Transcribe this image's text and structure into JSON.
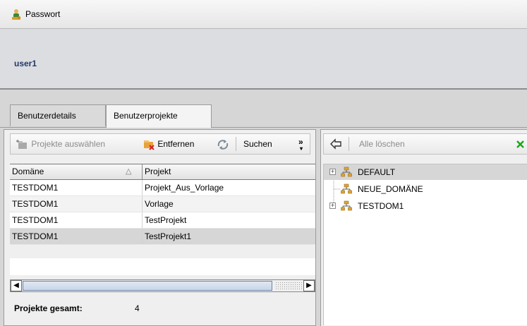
{
  "header": {
    "password_label": "Passwort",
    "user_name": "user1"
  },
  "tabs": [
    {
      "label": "Benutzerdetails",
      "active": false
    },
    {
      "label": "Benutzerprojekte",
      "active": true
    }
  ],
  "left_toolbar": {
    "select_projects": "Projekte auswählen",
    "remove": "Entfernen",
    "search": "Suchen",
    "overflow": "»"
  },
  "grid": {
    "columns": [
      "Domäne",
      "Projekt"
    ],
    "sort_indicator": "△",
    "rows": [
      {
        "domain": "TESTDOM1",
        "project": "Projekt_Aus_Vorlage"
      },
      {
        "domain": "TESTDOM1",
        "project": "Vorlage"
      },
      {
        "domain": "TESTDOM1",
        "project": "TestProjekt"
      },
      {
        "domain": "TESTDOM1",
        "project": "TestProjekt1"
      }
    ],
    "selected_row": 3
  },
  "totals": {
    "label": "Projekte gesamt:",
    "value": "4"
  },
  "right_toolbar": {
    "clear_all": "Alle löschen"
  },
  "tree": {
    "nodes": [
      {
        "label": "DEFAULT",
        "expander": "+",
        "selected": true
      },
      {
        "label": "NEUE_DOMÄNE",
        "expander": "",
        "selected": false
      },
      {
        "label": "TESTDOM1",
        "expander": "+",
        "selected": false
      }
    ]
  },
  "colors": {
    "user_name": "#203a6c",
    "selected_row": "#d6d6d6",
    "clear_x": "#1aa51a"
  }
}
